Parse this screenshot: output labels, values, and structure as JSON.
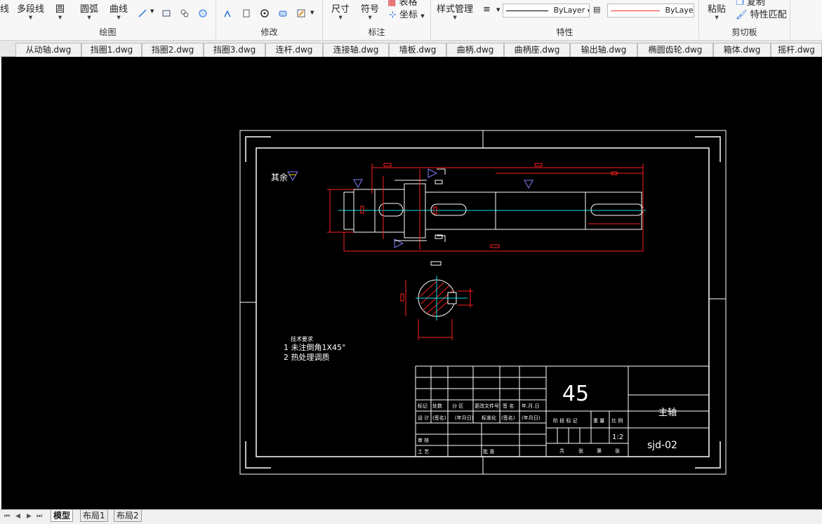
{
  "ribbon": {
    "draw_group": {
      "label": "绘图",
      "tools": [
        "线",
        "多段线",
        "圆",
        "圆弧",
        "曲线"
      ]
    },
    "modify_group": {
      "label": "修改"
    },
    "annotate_group": {
      "label": "标注",
      "dimension": "尺寸",
      "symbol": "符号",
      "table_partial": "表格",
      "coordinate": "坐标"
    },
    "properties_group": {
      "label": "特性",
      "style_manager": "样式管理",
      "linetype": "ByLayer",
      "color": "ByLayer"
    },
    "clipboard_group": {
      "label": "剪切板",
      "paste": "粘贴",
      "copy_partial": "复制",
      "match_props": "特性匹配"
    }
  },
  "tabs": [
    "从动轴.dwg",
    "挡圈1.dwg",
    "挡圈2.dwg",
    "挡圈3.dwg",
    "连杆.dwg",
    "连接轴.dwg",
    "墙板.dwg",
    "曲柄.dwg",
    "曲柄座.dwg",
    "输出轴.dwg",
    "椭圆齿轮.dwg",
    "箱体.dwg",
    "摇杆.dwg"
  ],
  "drawing": {
    "roughness_note": "其余",
    "tech_req_title": "技术要求",
    "tech_req_1": "1  未注倒角1X45°",
    "tech_req_2": "2  热处理调质",
    "title_block": {
      "material": "45",
      "part_name": "主轴",
      "drawing_no": "sjd-02",
      "scale": "1:2",
      "row_headers": [
        "标记",
        "处数",
        "分 区",
        "更改文件号",
        "签 名",
        "年.月.日"
      ],
      "row2": [
        "设 计",
        "(签名)",
        "(年月日)",
        "标准化",
        "(签名)",
        "(年月日)"
      ],
      "row3": [
        "审 核"
      ],
      "row4": [
        "工 艺",
        "批 准"
      ],
      "stage_headers": [
        "阶 段 标 记",
        "重 量",
        "比 例"
      ],
      "sheet_row": [
        "共",
        "张",
        "第",
        "张"
      ]
    }
  },
  "layout_tabs": [
    "模型",
    "布局1",
    "布局2"
  ],
  "colors": {
    "canvas": "#000000",
    "frame": "#ffffff",
    "dimension": "#ff2020",
    "centerline": "#00e0e0",
    "roughness": "#8080ff"
  }
}
